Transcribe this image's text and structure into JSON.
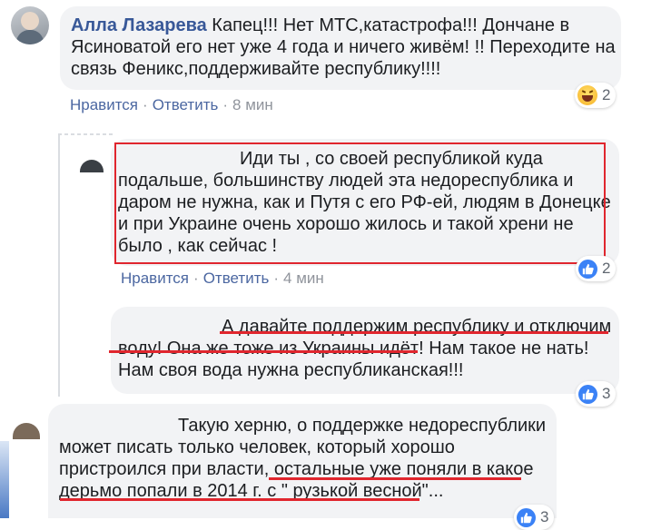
{
  "comment1": {
    "author": "Алла Лазарева",
    "text_line1": "Капец!!! Нет МТС,катастрофа!!! Дончане в",
    "text_line2": "Ясиноватой его нет уже 4 года и ничего живём! !! Переходите на",
    "text_line3": "связь Феникс,поддерживайте республику!!!!",
    "like_label": "Нравится",
    "reply_label": "Ответить",
    "time": "8 мин",
    "reaction_count": "2",
    "reaction_icon": "haha-icon"
  },
  "reply1": {
    "text_line1": "Иди ты , со своей республикой куда",
    "text_line2": "подальше, большинству людей эта недореспублика и",
    "text_line3": "даром не нужна, как и Путя с его РФ-ей, людям в Донецке",
    "text_line4": "и при Украине очень хорошо жилось и такой хрени не",
    "text_line5": "было , как сейчас !",
    "like_label": "Нравится",
    "reply_label": "Ответить",
    "time": "4 мин",
    "reaction_count": "2",
    "reaction_icon": "like-icon"
  },
  "reply2": {
    "text_line1": "А давайте поддержим республику и отключим",
    "text_line2a": "воду! Она же тоже из Украины идёт",
    "text_line2b": "! Нам такое не нать!",
    "text_line3": "Нам своя вода нужна республиканская!!!",
    "reaction_count": "3",
    "reaction_icon": "like-icon"
  },
  "comment2": {
    "text_line1": "Такую херню, о поддержке недореспублики",
    "text_line2": "может писать только человек, который хорошо",
    "text_line3a": "пристроился при власти, ",
    "text_line3b": "остальные уже поняли в какое",
    "text_line4a": "дерьмо попали в 2014 г. с \" рузькой весной",
    "text_line4b": "\"...",
    "reaction_count": "3",
    "reaction_icon": "like-icon"
  },
  "colors": {
    "bubble": "#f2f3f5",
    "link": "#4b67a1",
    "name": "#385898",
    "annotation": "#e0262e",
    "like": "#3b82f6"
  }
}
